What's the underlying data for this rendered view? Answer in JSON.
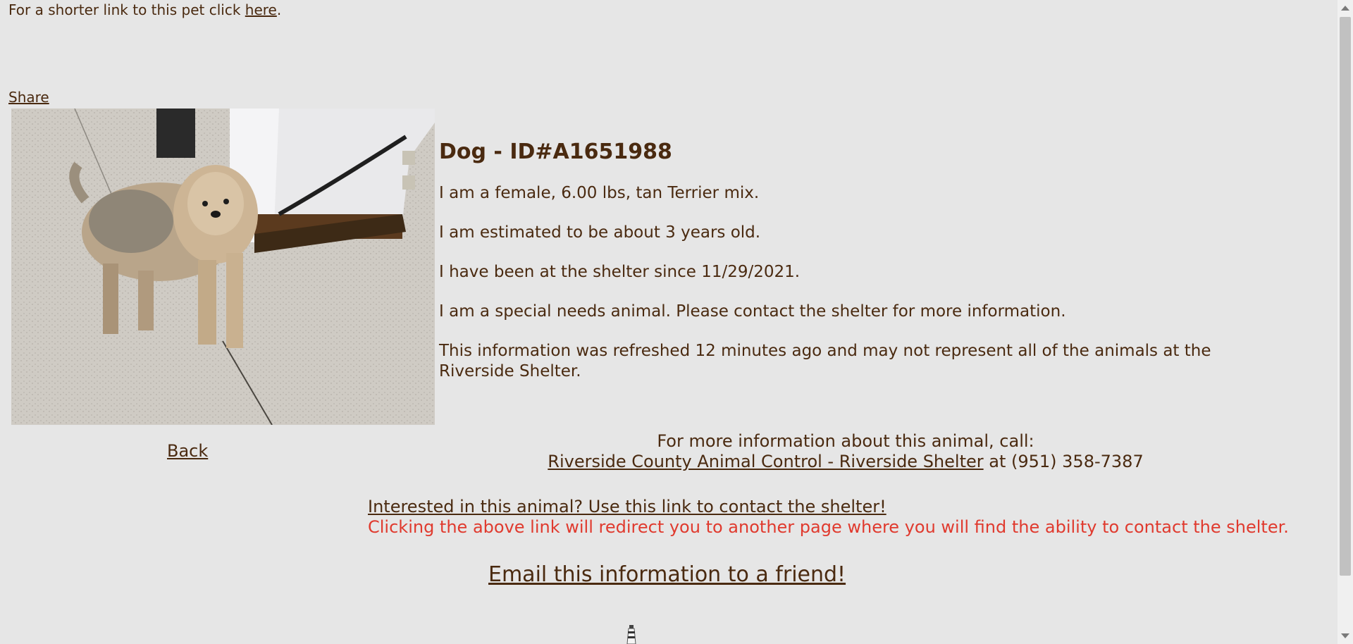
{
  "top": {
    "prefix": "For a shorter link to this pet click ",
    "link_label": "here",
    "suffix": "."
  },
  "share_label": "Share",
  "photo": {
    "icon": "dog-photo"
  },
  "animal": {
    "title": "Dog - ID#A1651988",
    "lines": [
      "I am a female, 6.00 lbs, tan Terrier mix.",
      "I am estimated to be about 3 years old.",
      "I have been at the shelter since 11/29/2021.",
      "I am a special needs animal. Please contact the shelter for more information.",
      "This information was refreshed 12 minutes ago and may not represent all of the animals at the Riverside Shelter."
    ]
  },
  "back_label": "Back",
  "call": {
    "heading": "For more information about this animal, call:",
    "shelter_link": "Riverside County Animal Control - Riverside Shelter",
    "phone_text": " at (951) 358-7387"
  },
  "interested": {
    "link_label": "Interested in this animal? Use this link to contact the shelter!",
    "warning": "Clicking the above link will redirect you to another page where you will find the ability to contact the shelter."
  },
  "email_label": "Email this information to a friend!",
  "colors": {
    "background": "#e6e6e6",
    "text": "#4a2a10",
    "warning": "#e03a2e"
  }
}
